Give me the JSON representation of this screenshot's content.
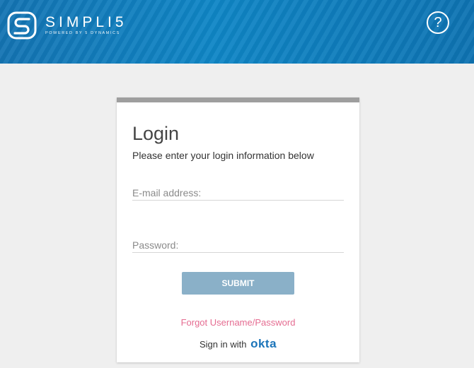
{
  "header": {
    "brand_name": "SIMPLI5",
    "brand_tagline": "POWERED BY 5 DYNAMICS",
    "help_symbol": "?",
    "colors": {
      "header_start": "#1474b3",
      "header_end": "#0e73b2"
    },
    "icons": {
      "logo": "simpli5-s-logo-icon",
      "help": "question-circle-icon"
    }
  },
  "login": {
    "title": "Login",
    "subtitle": "Please enter your login information below",
    "email_placeholder": "E-mail address:",
    "email_value": "",
    "password_placeholder": "Password:",
    "password_value": "",
    "submit_label": "SUBMIT",
    "forgot_link": "Forgot Username/Password",
    "okta_prefix": "Sign in with",
    "okta_brand": "okta",
    "colors": {
      "submit": "#8ab0c8",
      "forgot": "#e56c91",
      "okta": "#1b74b9",
      "card_top": "#9e9e9e"
    }
  }
}
